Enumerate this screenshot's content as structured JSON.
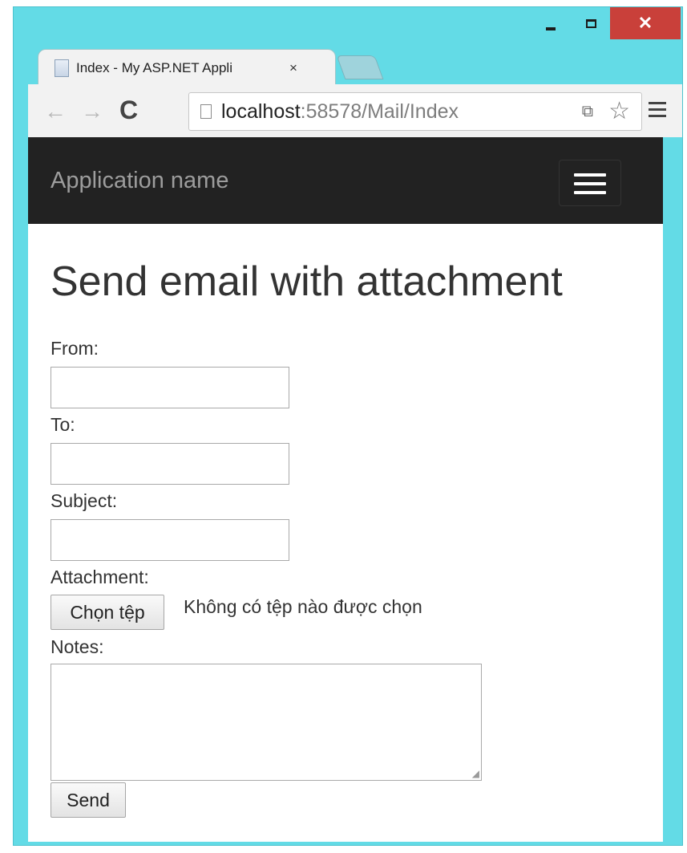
{
  "window": {
    "minimize_icon": "minimize-icon",
    "maximize_icon": "maximize-icon",
    "close_label": "✕"
  },
  "tab": {
    "title": "Index - My ASP.NET Appli",
    "close_label": "×"
  },
  "toolbar": {
    "back_glyph": "←",
    "forward_glyph": "→",
    "reload_glyph": "C",
    "url_host": "localhost",
    "url_path": ":58578/Mail/Index",
    "translate_glyph": "⧉",
    "star_glyph": "☆"
  },
  "navbar": {
    "brand": "Application name"
  },
  "page": {
    "heading": "Send email with attachment",
    "from_label": "From:",
    "to_label": "To:",
    "subject_label": "Subject:",
    "attachment_label": "Attachment:",
    "choose_file_label": "Chọn tệp",
    "no_file_text": "Không có tệp nào được chọn",
    "notes_label": "Notes:",
    "send_label": "Send"
  },
  "scrollbar": {
    "up_glyph": "▲",
    "down_glyph": "▼"
  },
  "colors": {
    "window_frame": "#63dbe6",
    "close_button": "#c9403a",
    "navbar_bg": "#222222",
    "brand_text": "#9d9d9d"
  }
}
